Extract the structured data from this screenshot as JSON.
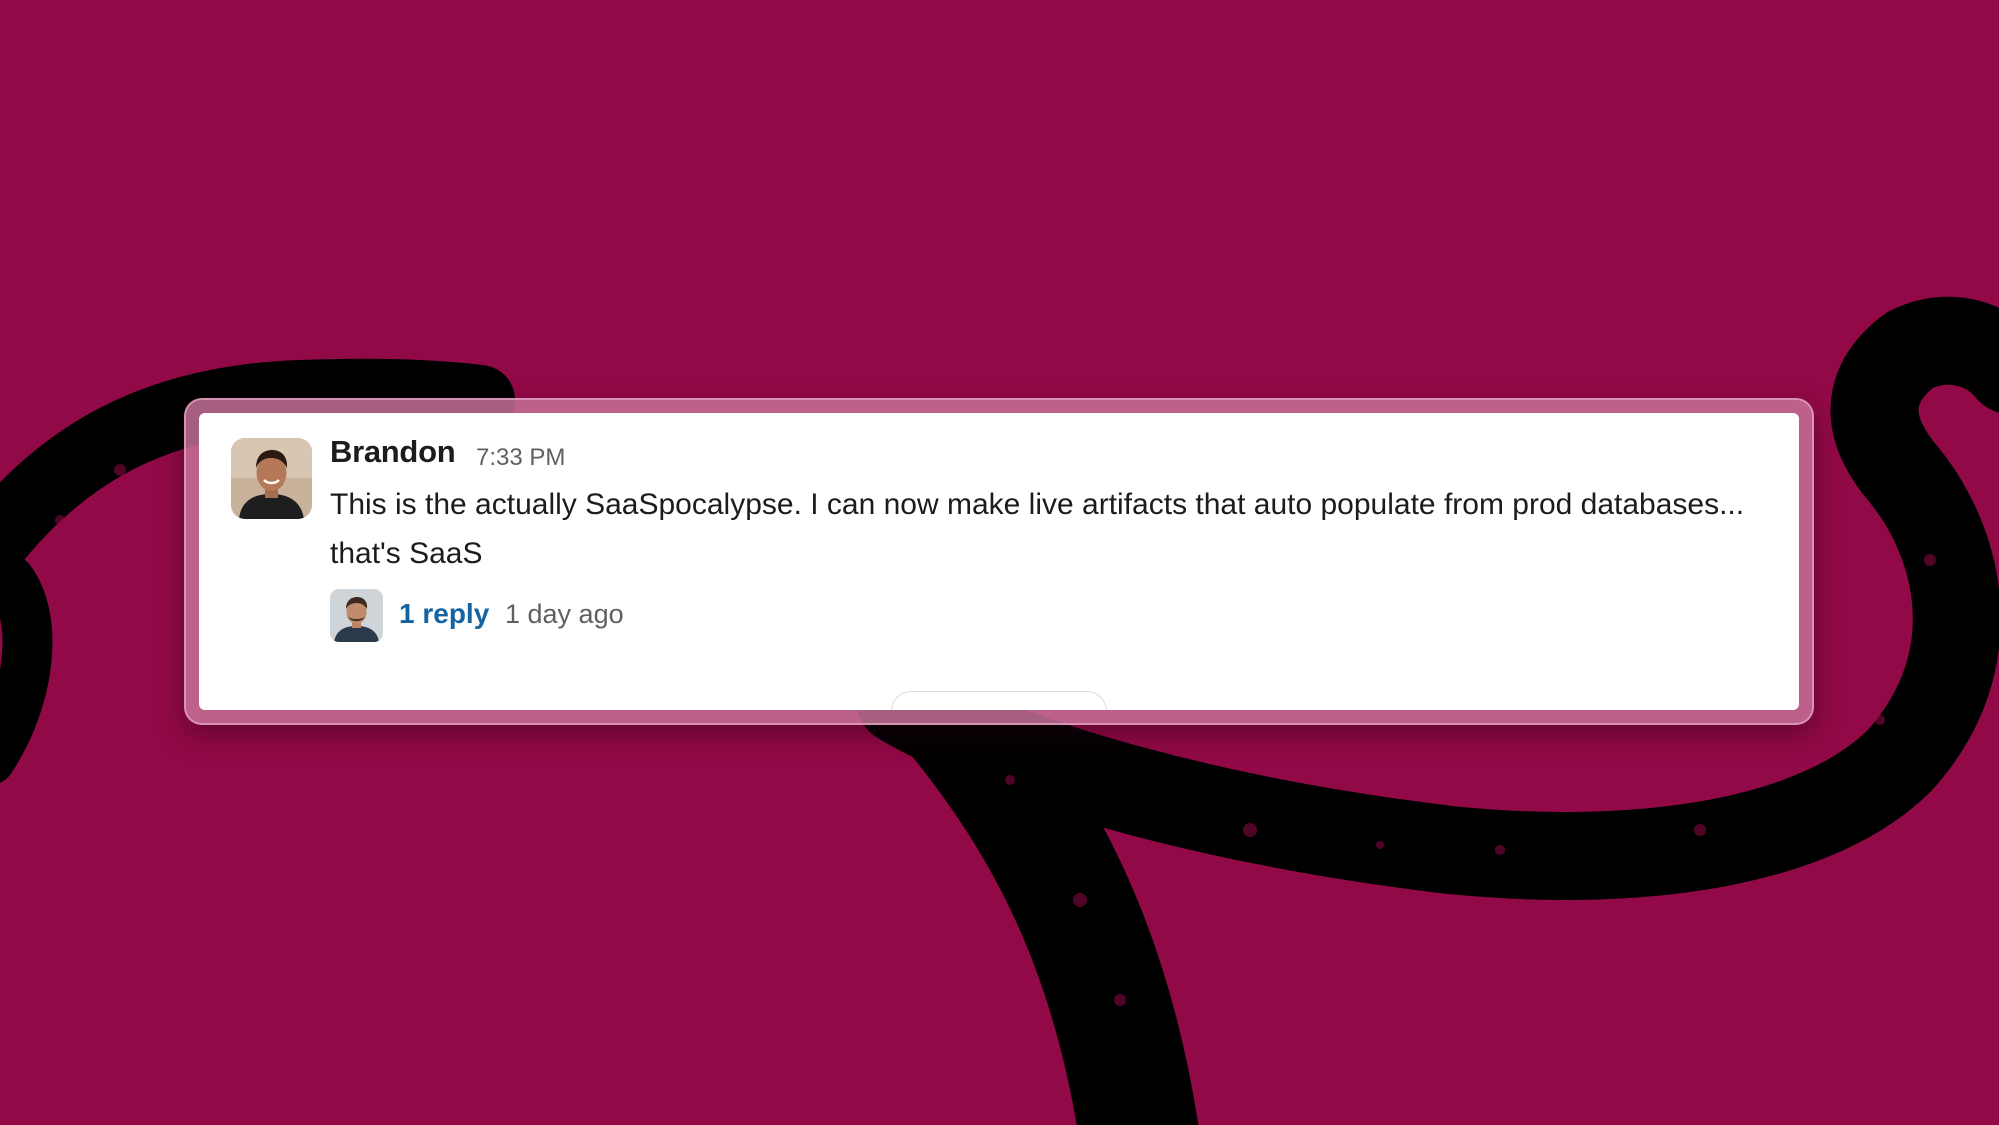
{
  "colors": {
    "background": "#920947",
    "swirl": "#000000",
    "card": "#ffffff",
    "link": "#1264a3",
    "muted_text": "#616061"
  },
  "message": {
    "author": "Brandon",
    "time": "7:33 PM",
    "text": "This is the actually SaaSpocalypse. I can now make live artifacts that auto populate from prod databases... that's SaaS",
    "avatar_icon": "person-avatar"
  },
  "thread": {
    "reply_count_label": "1 reply",
    "last_reply_time": "1 day ago",
    "avatar_icon": "person-avatar"
  }
}
